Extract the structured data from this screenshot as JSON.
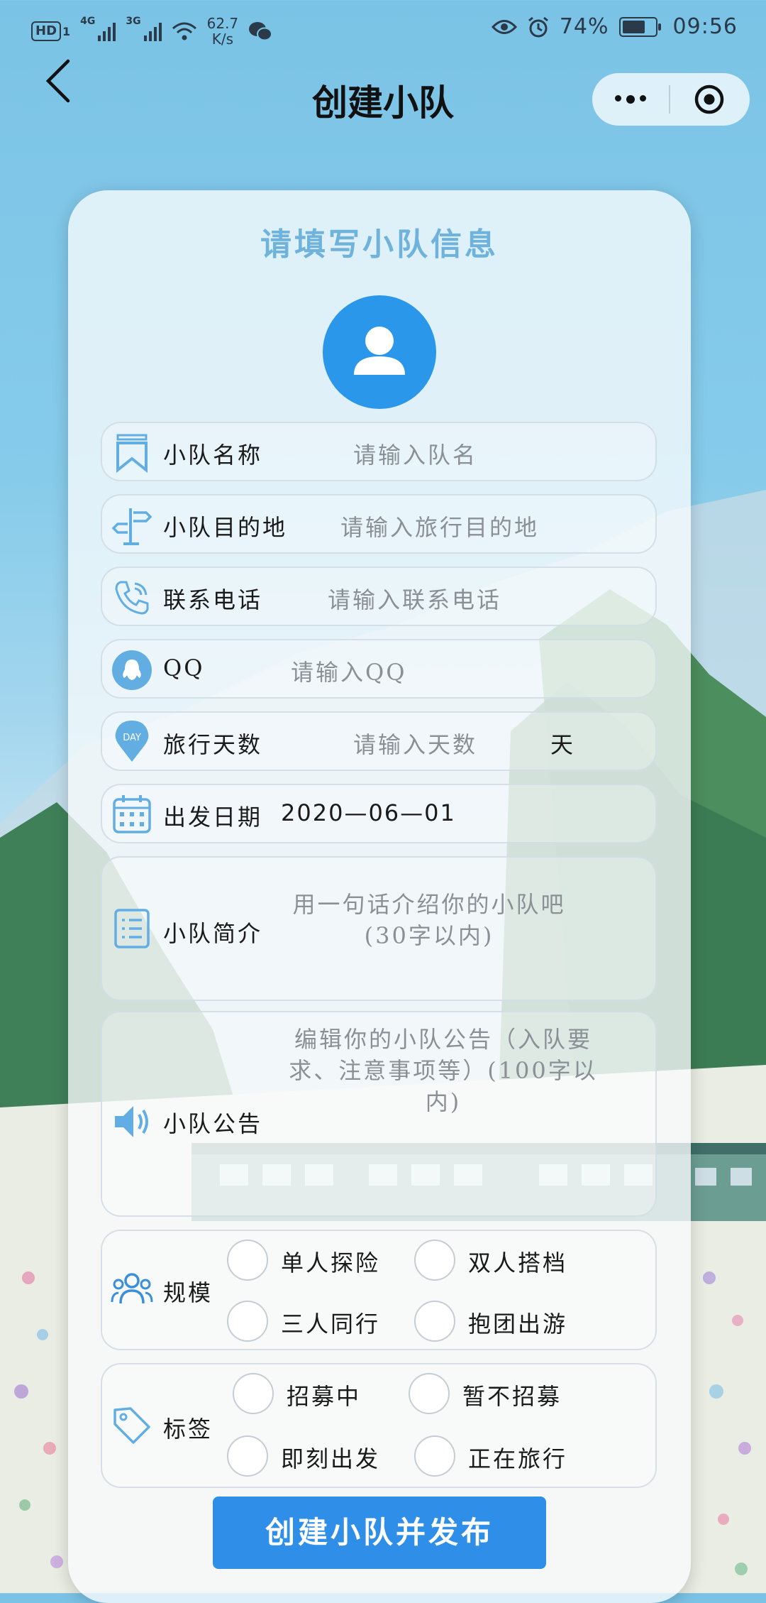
{
  "status_bar": {
    "hd": "HD",
    "sim1": "1",
    "net1": "4G",
    "net2": "3G",
    "speed_value": "62.7",
    "speed_unit": "K/s",
    "battery": "74%",
    "battery_level": 0.74,
    "time": "09:56"
  },
  "nav": {
    "title": "创建小队"
  },
  "card": {
    "title": "请填写小队信息"
  },
  "fields": {
    "name": {
      "label": "小队名称",
      "placeholder": "请输入队名"
    },
    "destination": {
      "label": "小队目的地",
      "placeholder": "请输入旅行目的地"
    },
    "phone": {
      "label": "联系电话",
      "placeholder": "请输入联系电话"
    },
    "qq": {
      "label": "QQ",
      "placeholder": "请输入QQ"
    },
    "days": {
      "label": "旅行天数",
      "placeholder": "请输入天数",
      "unit": "天",
      "icon_text": "DAY"
    },
    "date": {
      "label": "出发日期",
      "value": "2020—06—01"
    },
    "intro": {
      "label": "小队简介",
      "placeholder_line1": "用一句话介绍你的小队吧",
      "placeholder_line2": "(30字以内)"
    },
    "notice": {
      "label": "小队公告",
      "placeholder_line1": "编辑你的小队公告（入队要",
      "placeholder_line2": "求、注意事项等）(100字以",
      "placeholder_line3": "内)"
    }
  },
  "scale": {
    "label": "规模",
    "options": [
      "单人探险",
      "双人搭档",
      "三人同行",
      "抱团出游"
    ]
  },
  "tags": {
    "label": "标签",
    "options": [
      "招募中",
      "暂不招募",
      "即刻出发",
      "正在旅行"
    ]
  },
  "submit_label": "创建小队并发布",
  "colors": {
    "accent": "#2f8fe8",
    "avatar": "#2b97ea",
    "icon": "#62aee3",
    "card_title": "#6fb3dc"
  }
}
